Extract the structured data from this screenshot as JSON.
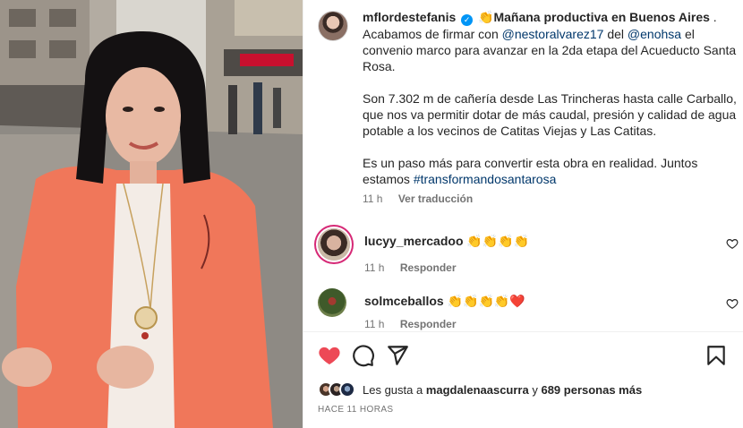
{
  "post": {
    "username": "mflordestefanis",
    "verified": true,
    "caption_emoji_1": "👏",
    "caption_title": "Mañana productiva en Buenos Aires",
    "caption_title_end": " .",
    "p1_a": "Acabamos de firmar con ",
    "p1_mention1": "@nestoralvarez17",
    "p1_b": " del ",
    "p1_mention2": "@enohsa",
    "p1_c": " el convenio marco para avanzar en la 2da etapa del Acueducto Santa Rosa.",
    "p2": "Son 7.302 m de cañería desde Las Trincheras hasta calle Carballo, que nos va permitir dotar de más caudal, presión y calidad de agua potable a los vecinos de Catitas Viejas y Las Catitas.",
    "p3_a": "Es un paso más para convertir esta obra en realidad. Juntos estamos ",
    "p3_tag": "#transformandosantarosa",
    "time_ago": "11 h",
    "see_translation": "Ver traducción"
  },
  "comments": [
    {
      "username": "lucyy_mercadoo",
      "text": "👏👏👏👏",
      "time_ago": "11 h",
      "reply": "Responder"
    },
    {
      "username": "solmceballos",
      "text": "👏👏👏👏❤️",
      "time_ago": "11 h",
      "reply": "Responder"
    }
  ],
  "likes": {
    "prefix": "Les gusta a ",
    "user": "magdalenaascurra",
    "middle": " y ",
    "count_text": "689 personas más"
  },
  "timestamp": "HACE 11 HORAS",
  "colors": {
    "like_red": "#ed4956",
    "link_blue": "#00376b",
    "verified_blue": "#0095f6",
    "muted": "#737373"
  },
  "icons": [
    "verified-badge-icon",
    "heart-filled-icon",
    "comment-icon",
    "share-icon",
    "bookmark-icon",
    "heart-outline-icon"
  ]
}
